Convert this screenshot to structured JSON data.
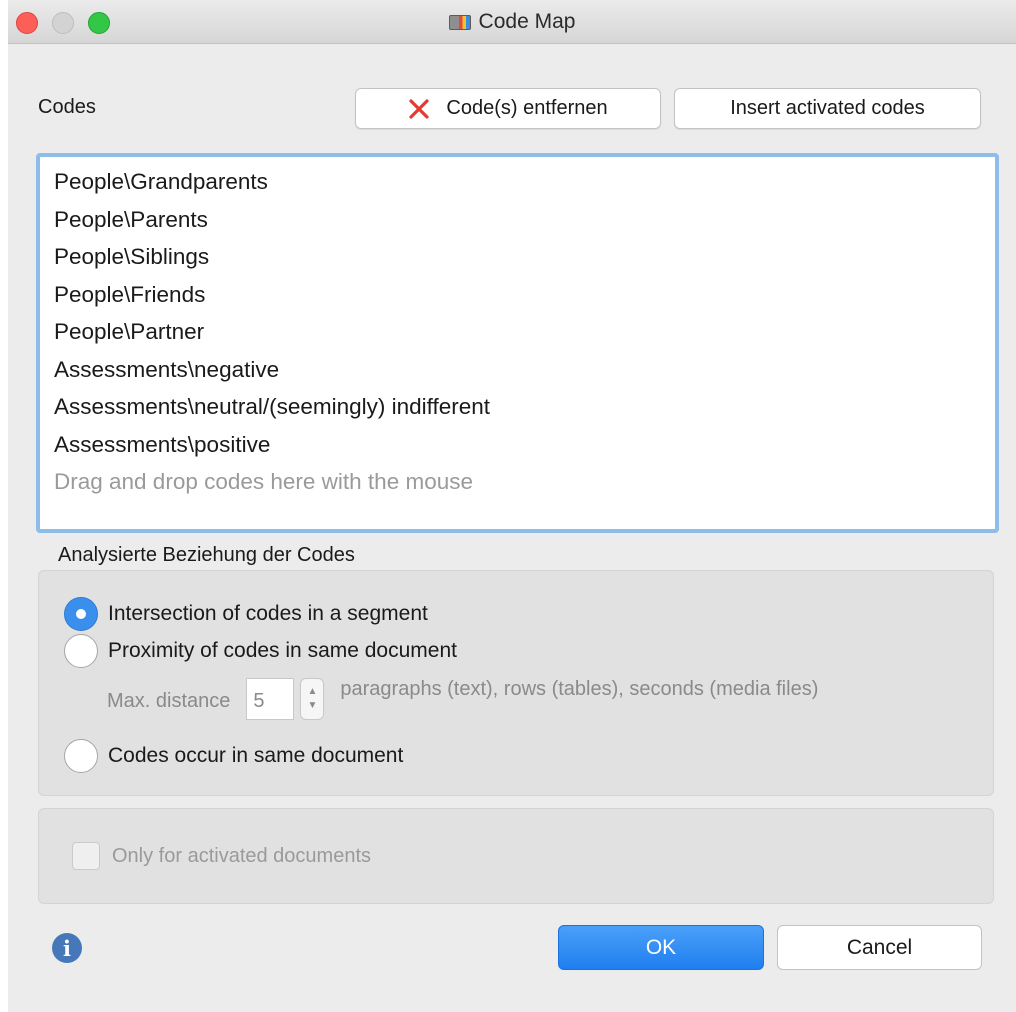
{
  "window": {
    "title": "Code Map",
    "app_icon": "code-map-icon"
  },
  "codes": {
    "label": "Codes",
    "remove_button": "Code(s) entfernen",
    "remove_icon": "red-x-icon",
    "insert_button": "Insert activated codes",
    "items": [
      "People\\Grandparents",
      "People\\Parents",
      "People\\Siblings",
      "People\\Friends",
      "People\\Partner",
      "Assessments\\negative",
      "Assessments\\neutral/(seemingly) indifferent",
      "Assessments\\positive"
    ],
    "drop_hint": "Drag and drop codes here with the mouse"
  },
  "relation": {
    "label": "Analysierte Beziehung der Codes",
    "options": [
      {
        "label": "Intersection of codes in a segment",
        "selected": true
      },
      {
        "label": "Proximity of codes in same document",
        "selected": false
      },
      {
        "label": "Codes occur in same document",
        "selected": false
      }
    ],
    "max_distance_label": "Max. distance",
    "max_distance_value": "5",
    "max_distance_unit": "paragraphs (text), rows (tables), seconds (media files)"
  },
  "documents": {
    "checkbox_label": "Only for activated documents",
    "checked": false
  },
  "footer": {
    "info_icon": "info-icon",
    "ok_label": "OK",
    "cancel_label": "Cancel"
  },
  "colors": {
    "accent": "#3b8fec",
    "remove_icon": "#e53a2f",
    "list_focus": "#8fbde9"
  }
}
